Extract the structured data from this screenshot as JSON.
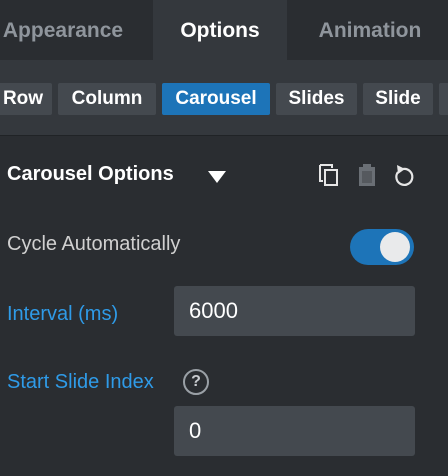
{
  "tabs": [
    {
      "label": "Appearance",
      "active": false
    },
    {
      "label": "Options",
      "active": true
    },
    {
      "label": "Animation",
      "active": false
    }
  ],
  "subnav": [
    {
      "label": "Row",
      "active": false
    },
    {
      "label": "Column",
      "active": false
    },
    {
      "label": "Carousel",
      "active": true
    },
    {
      "label": "Slides",
      "active": false
    },
    {
      "label": "Slide",
      "active": false
    },
    {
      "label": "",
      "active": false
    }
  ],
  "section": {
    "title": "Carousel Options",
    "actions": [
      {
        "icon": "copy-icon",
        "enabled": true
      },
      {
        "icon": "paste-icon",
        "enabled": false
      },
      {
        "icon": "reset-icon",
        "enabled": true
      }
    ]
  },
  "fields": {
    "cycle": {
      "label": "Cycle Automatically",
      "on": true
    },
    "interval": {
      "label": "Interval (ms)",
      "value": "6000"
    },
    "start_index": {
      "label": "Start Slide Index",
      "help": "?",
      "value": "0"
    }
  },
  "colors": {
    "accent": "#1d74b8",
    "link_label": "#2f9be8",
    "background": "#2a2d31",
    "toolbar": "#34383d"
  }
}
